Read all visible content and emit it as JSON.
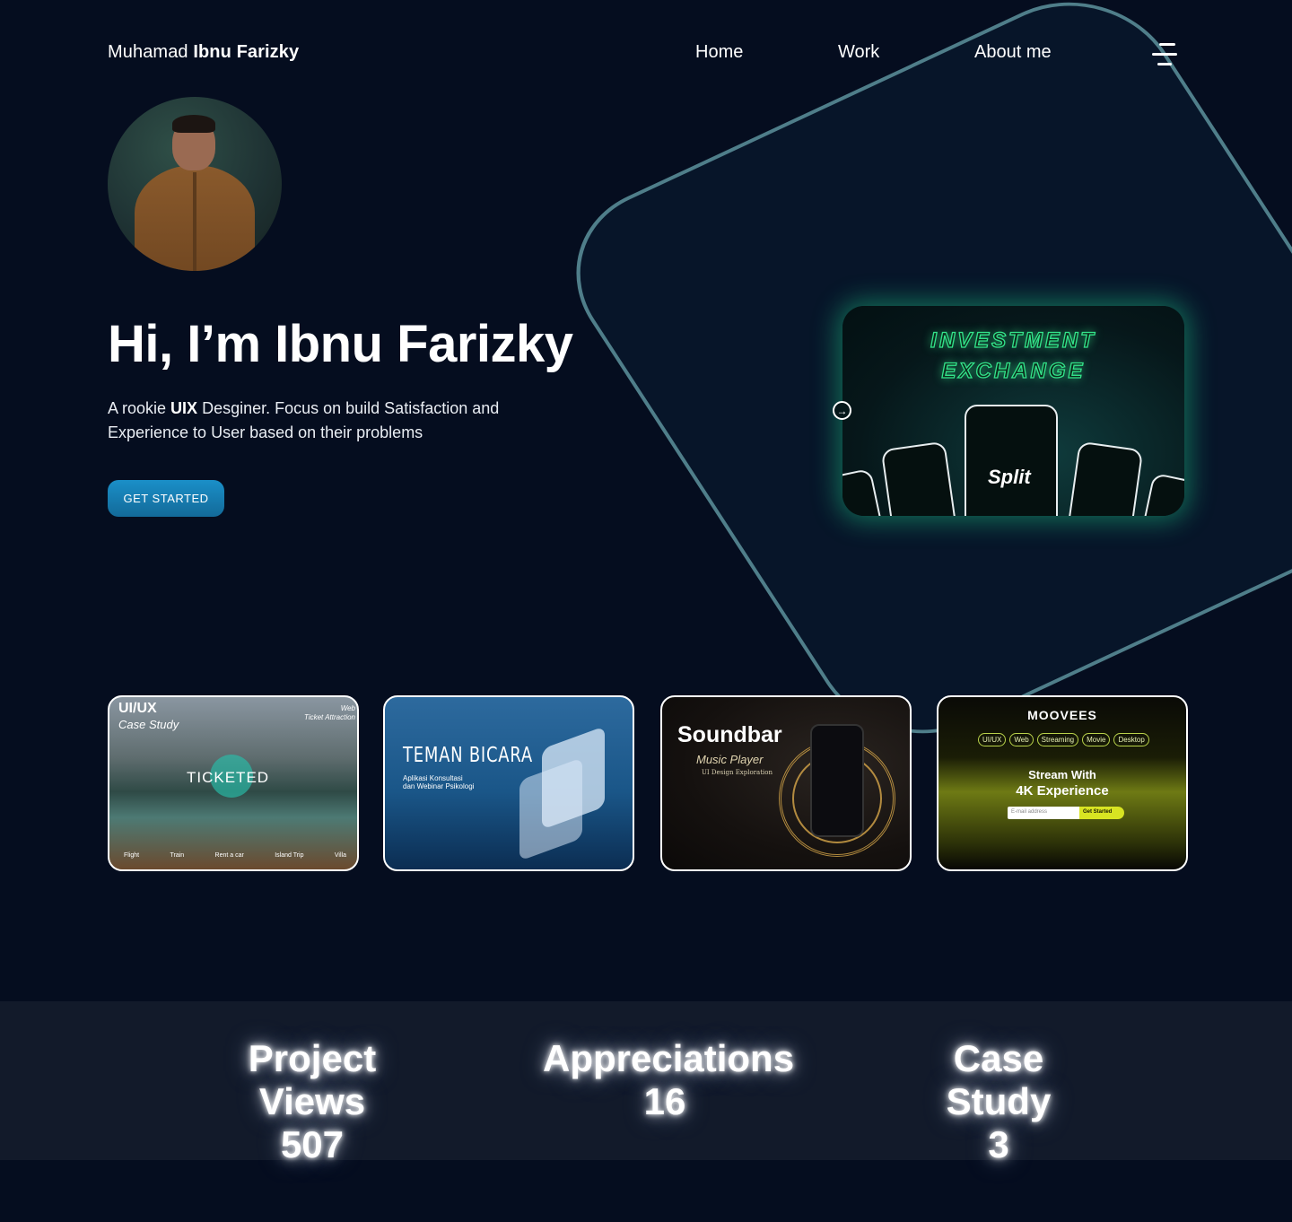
{
  "header": {
    "logo_first": "Muhamad",
    "logo_last": "Ibnu Farizky",
    "nav": [
      {
        "label": "Home"
      },
      {
        "label": "Work"
      },
      {
        "label": "About me"
      }
    ],
    "menu_icon": "hamburger-icon"
  },
  "hero": {
    "title": "Hi, I’m Ibnu Farizky",
    "desc_pre": "A rookie ",
    "desc_bold": "UIX",
    "desc_post": " Desginer. Focus on build Satisfaction and Experience to User based on their problems",
    "cta": "GET STARTED"
  },
  "featured": {
    "title_line1": "INVESTMENT",
    "title_line2": "EXCHANGE",
    "app_logo": "Split",
    "accent": "#33e38a",
    "arrow_icon": "arrow-right-circle-icon"
  },
  "projects": [
    {
      "title": "UI/UX",
      "subtitle": "Case Study",
      "tag_line1": "Web",
      "tag_line2": "Ticket Attraction",
      "logo": "TICKETED",
      "nav": [
        "Flight",
        "Train",
        "Rent a car",
        "Island Trip",
        "Villa"
      ]
    },
    {
      "title": "TEMAN BICARA",
      "subtitle_line1": "Aplikasi Konsultasi",
      "subtitle_line2": "dan Webinar Psikologi"
    },
    {
      "title": "Soundbar",
      "subtitle": "Music Player",
      "caption": "UI Design Exploration"
    },
    {
      "brand": "MOOVEES",
      "tags": [
        "UI/UX",
        "Web",
        "Streaming",
        "Movie",
        "Desktop"
      ],
      "headline_line1": "Stream With",
      "headline_line2": "4K Experience",
      "input_placeholder": "E-mail address",
      "button": "Get Started"
    }
  ],
  "stats": [
    {
      "label": "Project Views",
      "value": "507"
    },
    {
      "label": "Appreciations",
      "value": "16"
    },
    {
      "label": "Case Study",
      "value": "3"
    }
  ],
  "colors": {
    "background": "#050d1f",
    "shape_border": "#4f7e8a",
    "cta": "#1a8fc8",
    "stats_band": "#121a2a"
  }
}
